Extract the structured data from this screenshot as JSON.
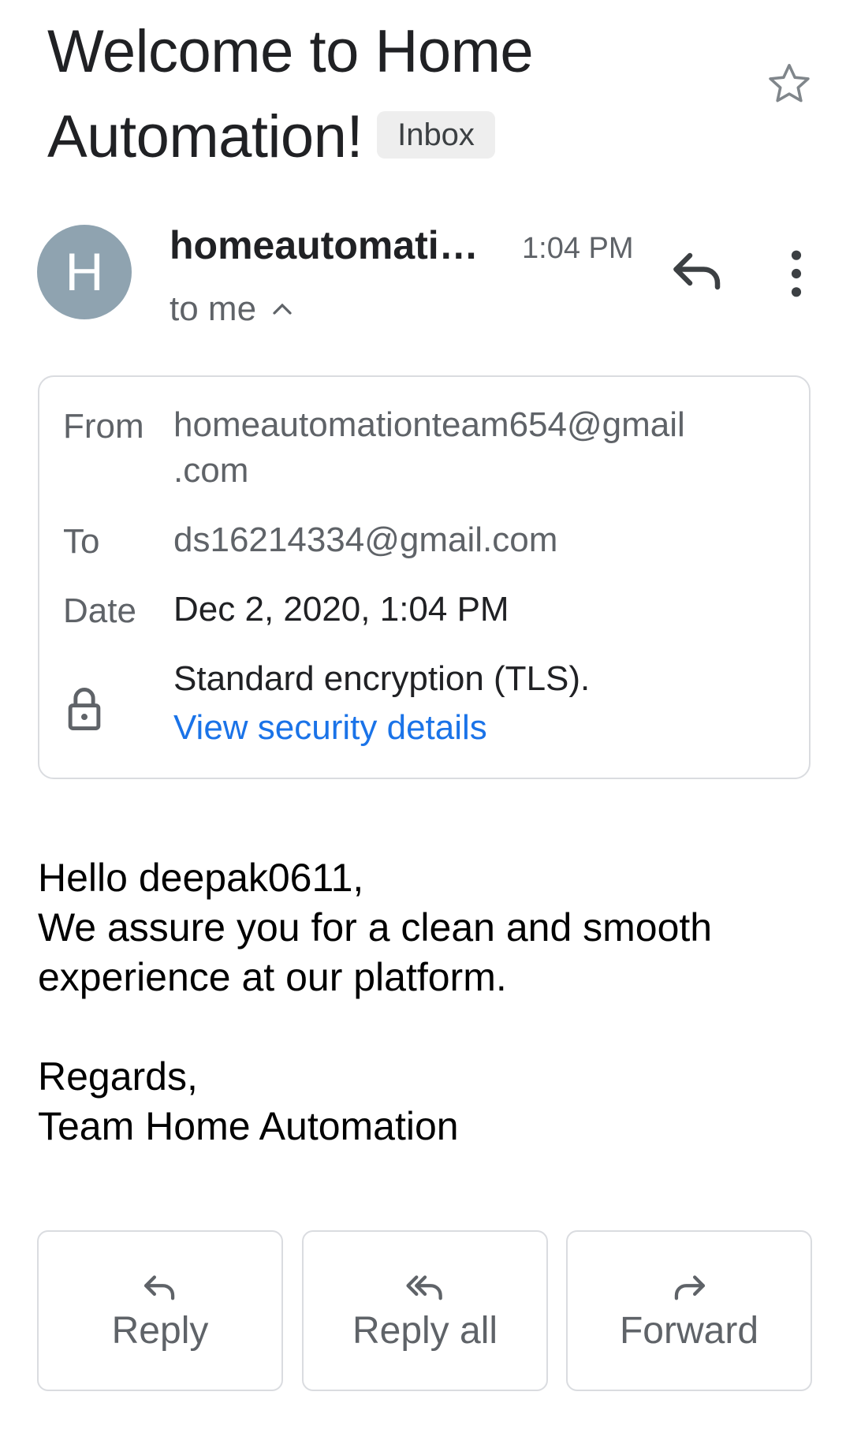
{
  "email": {
    "subject": "Welcome to Home Automation!",
    "label": "Inbox"
  },
  "sender": {
    "avatar_letter": "H",
    "name": "homeautomationteam654@gmail.com",
    "time": "1:04 PM",
    "recipient_summary": "to me"
  },
  "details": {
    "from_label": "From",
    "from_value_line1": "homeautomationteam654@gmail",
    "from_value_line2": ".com",
    "to_label": "To",
    "to_value": "ds16214334@gmail.com",
    "date_label": "Date",
    "date_value": "Dec 2, 2020, 1:04 PM",
    "encryption_text": "Standard encryption (TLS).",
    "security_link": "View security details"
  },
  "body": {
    "greeting": "Hello deepak0611,",
    "line1": "We assure you for a clean and smooth",
    "line2": "experience at our platform.",
    "closing": "Regards,",
    "signature": "Team Home Automation"
  },
  "actions": {
    "reply": "Reply",
    "reply_all": "Reply all",
    "forward": "Forward"
  },
  "icons": {
    "star": "star-outline-icon",
    "reply": "reply-arrow-icon",
    "more": "more-vert-icon",
    "lock": "lock-icon",
    "chevron": "chevron-up-icon"
  },
  "colors": {
    "avatar": "#8fa3b0",
    "link": "#1a73e8",
    "secondary_text": "#5f6368"
  }
}
